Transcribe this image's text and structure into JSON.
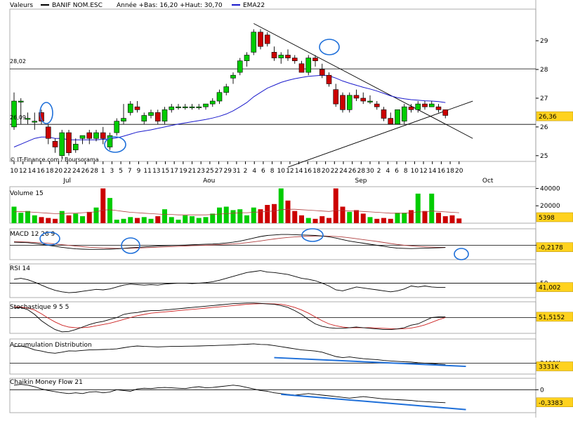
{
  "header": {
    "valeurs_label": "Valeurs",
    "series_name": "BANIF NOM.ESC",
    "range_text": "Année +Bas: 16,20 +Haut: 30,70",
    "ema_label": "EMA22",
    "credit": "© IT-Finance.com / Boursorama"
  },
  "colors": {
    "up": "#00cc00",
    "down": "#cc0000",
    "ema": "#1a1acc",
    "annotation": "#1e6fd9",
    "value_box": "#ffd21e"
  },
  "chart_data": [
    {
      "type": "candlestick",
      "name": "price",
      "ylim": [
        24.8,
        30.1
      ],
      "yticks": [
        25,
        26,
        27,
        28,
        29
      ],
      "reference_lines": [
        {
          "label": "28,02",
          "value": 28.02
        },
        {
          "label": "26,09",
          "value": 26.09
        }
      ],
      "last_value_label": "26,36",
      "x_tick_labels": [
        "10",
        "12",
        "14",
        "16",
        "18",
        "20",
        "22",
        "24",
        "26",
        "28",
        "1",
        "3",
        "5",
        "7",
        "9",
        "11",
        "13",
        "15",
        "17",
        "19",
        "21",
        "23",
        "25",
        "27",
        "29",
        "31",
        "2",
        "4",
        "6",
        "8",
        "10",
        "12",
        "14",
        "16",
        "18",
        "20",
        "22",
        "24",
        "26",
        "28",
        "30",
        "2",
        "4",
        "6",
        "8",
        "10",
        "12",
        "14",
        "16",
        "18",
        "20"
      ],
      "month_labels": [
        "Jul",
        "Aou",
        "Sep",
        "Oct"
      ],
      "candles": [
        {
          "o": 26.0,
          "h": 27.2,
          "l": 25.9,
          "c": 26.9
        },
        {
          "o": 26.9,
          "h": 27.0,
          "l": 26.1,
          "c": 26.9
        },
        {
          "o": 26.3,
          "h": 26.5,
          "l": 26.1,
          "c": 26.3
        },
        {
          "o": 26.2,
          "h": 26.5,
          "l": 25.9,
          "c": 26.2
        },
        {
          "o": 26.5,
          "h": 26.6,
          "l": 26.1,
          "c": 26.2
        },
        {
          "o": 26.0,
          "h": 26.1,
          "l": 25.4,
          "c": 25.6
        },
        {
          "o": 25.5,
          "h": 25.6,
          "l": 25.1,
          "c": 25.3
        },
        {
          "o": 25.0,
          "h": 25.9,
          "l": 24.9,
          "c": 25.8
        },
        {
          "o": 25.8,
          "h": 25.9,
          "l": 25.0,
          "c": 25.1
        },
        {
          "o": 25.2,
          "h": 25.6,
          "l": 25.1,
          "c": 25.4
        },
        {
          "o": 25.6,
          "h": 25.7,
          "l": 25.4,
          "c": 25.7
        },
        {
          "o": 25.8,
          "h": 25.9,
          "l": 25.4,
          "c": 25.6
        },
        {
          "o": 25.6,
          "h": 25.9,
          "l": 25.5,
          "c": 25.8
        },
        {
          "o": 25.8,
          "h": 26.0,
          "l": 25.4,
          "c": 25.6
        },
        {
          "o": 25.3,
          "h": 25.8,
          "l": 25.2,
          "c": 25.7
        },
        {
          "o": 25.8,
          "h": 26.3,
          "l": 25.7,
          "c": 26.2
        },
        {
          "o": 26.2,
          "h": 26.8,
          "l": 26.1,
          "c": 26.3
        },
        {
          "o": 26.5,
          "h": 26.9,
          "l": 26.4,
          "c": 26.8
        },
        {
          "o": 26.7,
          "h": 26.9,
          "l": 26.5,
          "c": 26.6
        },
        {
          "o": 26.2,
          "h": 26.5,
          "l": 26.1,
          "c": 26.4
        },
        {
          "o": 26.4,
          "h": 26.6,
          "l": 26.3,
          "c": 26.5
        },
        {
          "o": 26.5,
          "h": 26.6,
          "l": 26.1,
          "c": 26.2
        },
        {
          "o": 26.2,
          "h": 26.7,
          "l": 26.1,
          "c": 26.6
        },
        {
          "o": 26.6,
          "h": 26.8,
          "l": 26.5,
          "c": 26.7
        },
        {
          "o": 26.7,
          "h": 26.8,
          "l": 26.6,
          "c": 26.7
        },
        {
          "o": 26.7,
          "h": 26.8,
          "l": 26.6,
          "c": 26.7
        },
        {
          "o": 26.7,
          "h": 26.8,
          "l": 26.6,
          "c": 26.7
        },
        {
          "o": 26.7,
          "h": 26.8,
          "l": 26.6,
          "c": 26.7
        },
        {
          "o": 26.7,
          "h": 26.8,
          "l": 26.6,
          "c": 26.8
        },
        {
          "o": 26.8,
          "h": 27.0,
          "l": 26.7,
          "c": 26.9
        },
        {
          "o": 26.9,
          "h": 27.3,
          "l": 26.8,
          "c": 27.2
        },
        {
          "o": 27.2,
          "h": 27.5,
          "l": 27.1,
          "c": 27.4
        },
        {
          "o": 27.7,
          "h": 27.9,
          "l": 27.5,
          "c": 27.8
        },
        {
          "o": 27.9,
          "h": 28.4,
          "l": 27.8,
          "c": 28.3
        },
        {
          "o": 28.3,
          "h": 28.6,
          "l": 28.1,
          "c": 28.5
        },
        {
          "o": 28.6,
          "h": 29.4,
          "l": 28.5,
          "c": 29.3
        },
        {
          "o": 29.3,
          "h": 29.4,
          "l": 28.7,
          "c": 28.8
        },
        {
          "o": 29.2,
          "h": 29.3,
          "l": 28.8,
          "c": 28.9
        },
        {
          "o": 28.6,
          "h": 28.8,
          "l": 28.3,
          "c": 28.4
        },
        {
          "o": 28.4,
          "h": 28.6,
          "l": 28.2,
          "c": 28.5
        },
        {
          "o": 28.5,
          "h": 28.7,
          "l": 28.3,
          "c": 28.4
        },
        {
          "o": 28.4,
          "h": 28.5,
          "l": 28.2,
          "c": 28.3
        },
        {
          "o": 28.2,
          "h": 28.3,
          "l": 27.9,
          "c": 27.9
        },
        {
          "o": 27.9,
          "h": 28.5,
          "l": 27.8,
          "c": 28.4
        },
        {
          "o": 28.4,
          "h": 28.5,
          "l": 28.1,
          "c": 28.3
        },
        {
          "o": 28.0,
          "h": 28.2,
          "l": 27.7,
          "c": 27.8
        },
        {
          "o": 27.8,
          "h": 27.9,
          "l": 27.4,
          "c": 27.5
        },
        {
          "o": 27.3,
          "h": 27.5,
          "l": 26.7,
          "c": 26.8
        },
        {
          "o": 27.1,
          "h": 27.2,
          "l": 26.5,
          "c": 26.6
        },
        {
          "o": 26.6,
          "h": 27.2,
          "l": 26.5,
          "c": 27.1
        },
        {
          "o": 27.1,
          "h": 27.3,
          "l": 26.9,
          "c": 27.0
        },
        {
          "o": 27.0,
          "h": 27.2,
          "l": 26.8,
          "c": 26.9
        },
        {
          "o": 26.9,
          "h": 27.1,
          "l": 26.8,
          "c": 26.9
        },
        {
          "o": 26.8,
          "h": 26.9,
          "l": 26.6,
          "c": 26.7
        },
        {
          "o": 26.6,
          "h": 26.7,
          "l": 26.2,
          "c": 26.3
        },
        {
          "o": 26.3,
          "h": 26.5,
          "l": 26.1,
          "c": 26.1
        },
        {
          "o": 26.1,
          "h": 26.6,
          "l": 26.1,
          "c": 26.6
        },
        {
          "o": 26.2,
          "h": 26.8,
          "l": 26.1,
          "c": 26.7
        },
        {
          "o": 26.7,
          "h": 26.8,
          "l": 26.5,
          "c": 26.6
        },
        {
          "o": 26.6,
          "h": 26.9,
          "l": 26.5,
          "c": 26.8
        },
        {
          "o": 26.8,
          "h": 26.9,
          "l": 26.6,
          "c": 26.7
        },
        {
          "o": 26.7,
          "h": 26.9,
          "l": 26.7,
          "c": 26.8
        },
        {
          "o": 26.7,
          "h": 26.8,
          "l": 26.5,
          "c": 26.6
        },
        {
          "o": 26.6,
          "h": 26.6,
          "l": 26.3,
          "c": 26.4
        }
      ],
      "ema": [
        25.3,
        25.4,
        25.5,
        25.6,
        25.65,
        25.65,
        25.6,
        25.6,
        25.55,
        25.55,
        25.55,
        25.55,
        25.55,
        25.57,
        25.58,
        25.62,
        25.68,
        25.75,
        25.82,
        25.86,
        25.9,
        25.95,
        26.0,
        26.05,
        26.1,
        26.14,
        26.18,
        26.22,
        26.26,
        26.31,
        26.37,
        26.45,
        26.56,
        26.7,
        26.85,
        27.05,
        27.2,
        27.35,
        27.45,
        27.55,
        27.62,
        27.68,
        27.72,
        27.76,
        27.78,
        27.8,
        27.78,
        27.7,
        27.6,
        27.52,
        27.45,
        27.38,
        27.32,
        27.25,
        27.17,
        27.08,
        27.02,
        26.98,
        26.95,
        26.93,
        26.91,
        26.9,
        26.88,
        26.85
      ],
      "trendlines": [
        {
          "from": [
            35,
            29.6
          ],
          "to": [
            67,
            25.6
          ]
        },
        {
          "from": [
            40,
            24.6
          ],
          "to": [
            67,
            26.9
          ]
        }
      ]
    },
    {
      "type": "bar",
      "name": "Volume 15",
      "yticks": [
        "40000",
        "20000"
      ],
      "ylim": [
        0,
        42000
      ],
      "last_value_label": "5398",
      "values": [
        19000,
        12000,
        14000,
        9000,
        7000,
        6000,
        5000,
        14000,
        9000,
        11000,
        8000,
        13000,
        18000,
        40000,
        29000,
        4000,
        5000,
        7000,
        6000,
        7000,
        5000,
        8000,
        16000,
        7000,
        4000,
        9000,
        8000,
        6000,
        7000,
        11000,
        18000,
        19000,
        15000,
        16000,
        9000,
        18000,
        16000,
        21000,
        22000,
        40000,
        26000,
        14000,
        9000,
        6000,
        5000,
        8000,
        6000,
        40000,
        19000,
        13000,
        15000,
        11000,
        7000,
        5000,
        6000,
        5000,
        12000,
        12000,
        15000,
        34000,
        14000,
        34000,
        12000,
        8000,
        9000,
        5398
      ],
      "ma": [
        13000,
        13500,
        13000,
        12500,
        12000,
        11500,
        11000,
        11000,
        11500,
        11500,
        12000,
        12500,
        13000,
        15000,
        15500,
        14500,
        13500,
        12500,
        12000,
        11500,
        11000,
        10500,
        10000,
        10000,
        9500,
        9500,
        9500,
        9500,
        9500,
        10000,
        10500,
        11000,
        11500,
        12000,
        12000,
        12500,
        13000,
        13500,
        14000,
        15500,
        16000,
        16000,
        15500,
        15000,
        14500,
        14000,
        13500,
        14500,
        14500,
        14000,
        14000,
        13500,
        13000,
        12500,
        12000,
        11500,
        11500,
        11500,
        12000,
        13000,
        13000,
        14000,
        13500,
        13000,
        12500,
        12000
      ]
    },
    {
      "type": "line",
      "name": "MACD 12 26 9",
      "ylim": [
        -1.4,
        1.6
      ],
      "yticks": [
        "0"
      ],
      "last_value_label": "-0,2178",
      "macd": [
        0.3,
        0.28,
        0.25,
        0.18,
        0.1,
        0.0,
        -0.1,
        -0.2,
        -0.28,
        -0.35,
        -0.38,
        -0.4,
        -0.4,
        -0.4,
        -0.38,
        -0.35,
        -0.3,
        -0.25,
        -0.2,
        -0.16,
        -0.12,
        -0.08,
        -0.05,
        -0.02,
        0.0,
        0.02,
        0.05,
        0.08,
        0.1,
        0.12,
        0.16,
        0.22,
        0.3,
        0.4,
        0.55,
        0.7,
        0.85,
        0.95,
        1.0,
        1.05,
        1.05,
        1.03,
        1.0,
        0.98,
        0.95,
        0.9,
        0.82,
        0.7,
        0.55,
        0.4,
        0.3,
        0.2,
        0.1,
        0.0,
        -0.1,
        -0.2,
        -0.28,
        -0.3,
        -0.32,
        -0.3,
        -0.28,
        -0.26,
        -0.24,
        -0.22
      ],
      "signal": [
        0.35,
        0.33,
        0.31,
        0.28,
        0.24,
        0.19,
        0.13,
        0.06,
        -0.01,
        -0.08,
        -0.14,
        -0.19,
        -0.23,
        -0.27,
        -0.29,
        -0.3,
        -0.3,
        -0.29,
        -0.27,
        -0.25,
        -0.22,
        -0.19,
        -0.16,
        -0.13,
        -0.1,
        -0.07,
        -0.04,
        -0.02,
        0.0,
        0.03,
        0.06,
        0.09,
        0.13,
        0.18,
        0.25,
        0.33,
        0.42,
        0.52,
        0.61,
        0.69,
        0.76,
        0.81,
        0.85,
        0.88,
        0.9,
        0.9,
        0.89,
        0.86,
        0.8,
        0.73,
        0.64,
        0.55,
        0.46,
        0.37,
        0.27,
        0.17,
        0.08,
        0.0,
        -0.06,
        -0.11,
        -0.15,
        -0.18,
        -0.2,
        -0.21
      ]
    },
    {
      "type": "line",
      "name": "RSI 14",
      "ylim": [
        20,
        90
      ],
      "yticks": [
        "50"
      ],
      "last_value_label": "41,002",
      "values": [
        58,
        60,
        57,
        52,
        46,
        40,
        35,
        32,
        30,
        31,
        33,
        35,
        37,
        36,
        38,
        42,
        46,
        48,
        47,
        46,
        47,
        46,
        48,
        49,
        50,
        50,
        49,
        50,
        51,
        53,
        56,
        60,
        64,
        68,
        72,
        74,
        76,
        73,
        72,
        70,
        68,
        64,
        60,
        58,
        55,
        50,
        44,
        36,
        34,
        38,
        42,
        40,
        38,
        36,
        34,
        32,
        34,
        38,
        44,
        42,
        44,
        42,
        41,
        41
      ]
    },
    {
      "type": "line",
      "name": "Stochastique 9 5 5",
      "ylim": [
        0,
        100
      ],
      "yticks": [
        "50"
      ],
      "last_value_label": "51,5152",
      "k": [
        80,
        82,
        75,
        60,
        40,
        25,
        12,
        5,
        6,
        12,
        20,
        28,
        34,
        38,
        44,
        50,
        60,
        64,
        66,
        70,
        72,
        72,
        74,
        76,
        78,
        80,
        82,
        84,
        86,
        88,
        90,
        92,
        94,
        95,
        96,
        96,
        95,
        93,
        92,
        88,
        82,
        72,
        60,
        44,
        30,
        22,
        18,
        16,
        16,
        18,
        20,
        18,
        16,
        14,
        12,
        12,
        14,
        18,
        26,
        30,
        40,
        50,
        52,
        52
      ],
      "d": [
        84,
        83,
        80,
        74,
        62,
        48,
        36,
        26,
        20,
        18,
        18,
        20,
        24,
        28,
        32,
        38,
        44,
        50,
        56,
        60,
        64,
        66,
        68,
        70,
        72,
        74,
        76,
        78,
        80,
        82,
        84,
        86,
        88,
        90,
        92,
        93,
        94,
        94,
        93,
        92,
        88,
        82,
        74,
        64,
        52,
        40,
        30,
        24,
        20,
        18,
        18,
        18,
        18,
        17,
        16,
        15,
        14,
        15,
        17,
        21,
        27,
        35,
        43,
        50
      ]
    },
    {
      "type": "line",
      "name": "Accumulation Distribution",
      "ylim": [
        2900,
        4500
      ],
      "yticks": [
        "3400K"
      ],
      "last_value_label": "3331K",
      "values": [
        4150,
        4180,
        4120,
        4000,
        3950,
        3880,
        3850,
        3900,
        3960,
        3950,
        3980,
        4000,
        4010,
        4020,
        4030,
        4050,
        4100,
        4150,
        4180,
        4160,
        4150,
        4140,
        4150,
        4160,
        4160,
        4170,
        4175,
        4180,
        4190,
        4200,
        4210,
        4220,
        4230,
        4250,
        4260,
        4280,
        4250,
        4240,
        4200,
        4150,
        4100,
        4050,
        4000,
        3980,
        3950,
        3900,
        3800,
        3700,
        3650,
        3680,
        3640,
        3600,
        3580,
        3560,
        3520,
        3500,
        3480,
        3460,
        3450,
        3420,
        3400,
        3380,
        3350,
        3331
      ],
      "trendline": {
        "from": [
          38,
          3650
        ],
        "to": [
          66,
          3250
        ]
      }
    },
    {
      "type": "line",
      "name": "Chaikin Money Flow 21",
      "ylim": [
        -0.6,
        0.3
      ],
      "yticks": [
        "0"
      ],
      "last_value_label": "-0,3383",
      "values": [
        0.12,
        0.14,
        0.12,
        0.08,
        0.02,
        -0.02,
        -0.05,
        -0.08,
        -0.1,
        -0.08,
        -0.1,
        -0.06,
        -0.05,
        -0.08,
        -0.06,
        0.0,
        -0.02,
        -0.04,
        0.02,
        0.04,
        0.03,
        0.05,
        0.06,
        0.05,
        0.04,
        0.03,
        0.06,
        0.08,
        0.05,
        0.06,
        0.08,
        0.1,
        0.12,
        0.1,
        0.06,
        0.02,
        -0.02,
        -0.04,
        -0.08,
        -0.1,
        -0.12,
        -0.14,
        -0.12,
        -0.1,
        -0.12,
        -0.14,
        -0.16,
        -0.18,
        -0.2,
        -0.22,
        -0.2,
        -0.18,
        -0.2,
        -0.22,
        -0.24,
        -0.25,
        -0.26,
        -0.27,
        -0.28,
        -0.3,
        -0.31,
        -0.32,
        -0.33,
        -0.34
      ],
      "trendline": {
        "from": [
          39,
          -0.12
        ],
        "to": [
          66,
          -0.52
        ]
      }
    }
  ]
}
